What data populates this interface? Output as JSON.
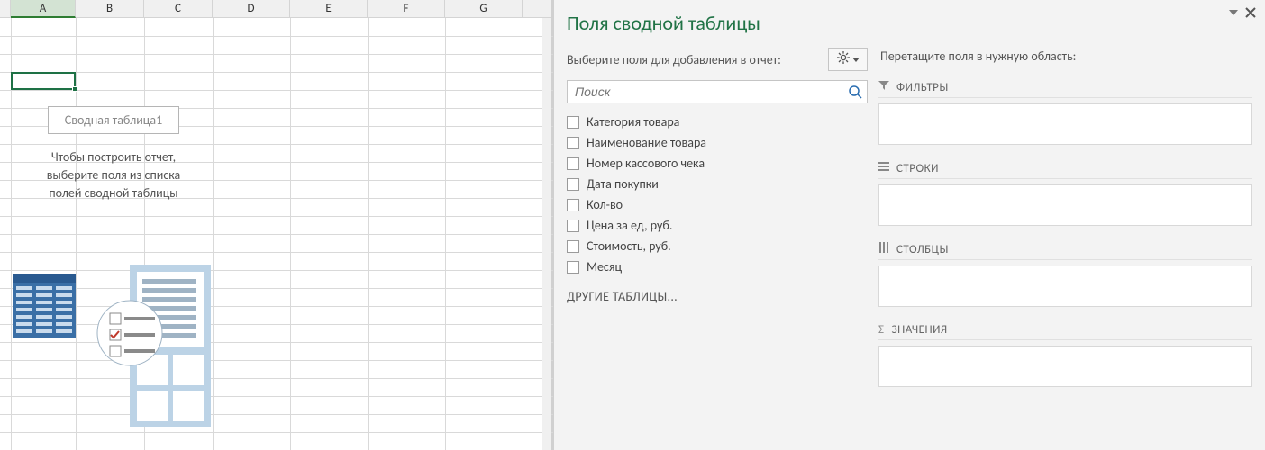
{
  "grid": {
    "columns": [
      "A",
      "B",
      "C",
      "D",
      "E",
      "F",
      "G"
    ],
    "selected_column_index": 0,
    "selected_cell": "A4"
  },
  "pivot_placeholder": {
    "title": "Сводная таблица1",
    "hint_line1": "Чтобы построить отчет,",
    "hint_line2": "выберите поля из списка",
    "hint_line3": "полей сводной таблицы"
  },
  "pane": {
    "title": "Поля сводной таблицы",
    "select_label": "Выберите поля для добавления в отчет:",
    "search_placeholder": "Поиск",
    "fields": [
      "Категория товара",
      "Наименование товара",
      "Номер кассового чека",
      "Дата покупки",
      "Кол-во",
      "Цена за ед, руб.",
      "Стоимость, руб.",
      "Месяц"
    ],
    "other_tables": "ДРУГИЕ ТАБЛИЦЫ...",
    "drag_hint": "Перетащите поля в нужную область:",
    "areas": {
      "filters": "ФИЛЬТРЫ",
      "rows": "СТРОКИ",
      "columns": "СТОЛБЦЫ",
      "values": "ЗНАЧЕНИЯ"
    }
  }
}
